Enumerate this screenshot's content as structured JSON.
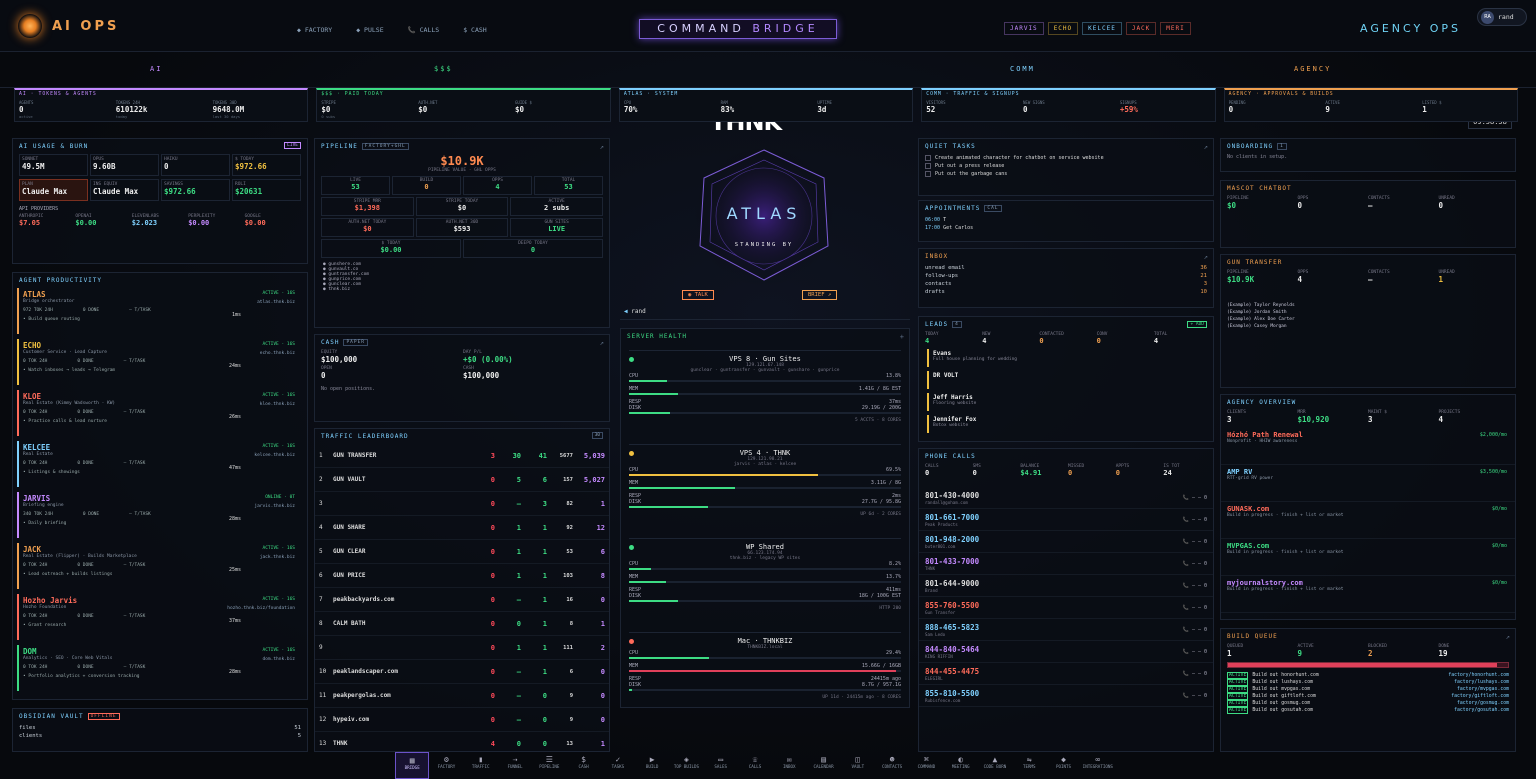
{
  "header": {
    "brand": "AI OPS",
    "nav": [
      "◆ FACTORY",
      "◆ PULSE",
      "📞 CALLS",
      "$ CASH"
    ],
    "title_a": "COMMAND ",
    "title_b": "BRIDGE",
    "agents": [
      "JARVIS",
      "ECHO",
      "KELCEE",
      "JACK",
      "MERI"
    ],
    "agency": "AGENCY OPS",
    "user_initials": "RA",
    "user_name": "rand"
  },
  "sections": {
    "ai": "AI",
    "money": "$$$",
    "brand": "THNK",
    "comm": "COMM",
    "agency": "AGENCY",
    "clock": "09:58:58"
  },
  "stats": [
    {
      "h": "AI · TOKENS & AGENTS",
      "cells": [
        [
          "AGENTS",
          "0",
          "active"
        ],
        [
          "TOKENS 24H",
          "610122k",
          "today"
        ],
        [
          "TOKENS 30D",
          "9648.0M",
          "last 30 days"
        ]
      ]
    },
    {
      "h": "$$$ · PAID TODAY",
      "cells": [
        [
          "STRIPE",
          "$0",
          "0 subs"
        ],
        [
          "AUTH.NET",
          "$0",
          ""
        ],
        [
          "GUIDE $",
          "$0",
          ""
        ]
      ]
    },
    {
      "h": "ATLAS · SYSTEM",
      "cells": [
        [
          "CPU",
          "70%",
          ""
        ],
        [
          "RAM",
          "83%",
          ""
        ],
        [
          "UPTIME",
          "3d",
          ""
        ]
      ]
    },
    {
      "h": "COMM · TRAFFIC & SIGNUPS",
      "cells": [
        [
          "VISITORS",
          "52",
          ""
        ],
        [
          "NEW SIGNS",
          "0",
          ""
        ],
        [
          "SIGNUPS",
          "+59%",
          ""
        ]
      ]
    },
    {
      "h": "AGENCY · APPROVALS & BUILDS",
      "cells": [
        [
          "PENDING",
          "0",
          ""
        ],
        [
          "ACTIVE",
          "9",
          ""
        ],
        [
          "LISTED $",
          "1",
          ""
        ]
      ]
    }
  ],
  "ai_usage": {
    "title": "AI USAGE & BURN",
    "tag": "LIVE",
    "row1": [
      [
        "SONNET",
        "49.5M"
      ],
      [
        "OPUS",
        "9.60B"
      ],
      [
        "HAIKU",
        "0"
      ],
      [
        "$ TODAY",
        "$972.66"
      ]
    ],
    "row2": [
      [
        "PLAN",
        "Claude Max"
      ],
      [
        "INS EQUIV",
        "Claude Max"
      ],
      [
        "SAVINGS",
        "$972.66"
      ],
      [
        "ROLI",
        "$20631"
      ]
    ],
    "providers_label": "API PROVIDERS",
    "providers": [
      [
        "ANTHROPIC",
        "$7.05"
      ],
      [
        "OPENAI",
        "$0.00"
      ],
      [
        "ELEVENLABS",
        "$2.023"
      ],
      [
        "PERPLEXITY",
        "$0.00"
      ],
      [
        "GOOGLE",
        "$0.00"
      ]
    ]
  },
  "agents_title": "AGENT PRODUCTIVITY",
  "agents": [
    {
      "name": "ATLAS",
      "color": "#f0a050",
      "status": "ACTIVE · 16S",
      "host": "atlas.thnk.biz",
      "desc": "Bridge orchestrator",
      "tok": "972 TOK 24H",
      "done": "0 DONE",
      "task": "— T/TASK",
      "ms": "1ms",
      "next": "• Build queue routing"
    },
    {
      "name": "ECHO",
      "color": "#f0c040",
      "status": "ACTIVE · 16S",
      "host": "echo.thnk.biz",
      "desc": "Customer Service · Lead Capture",
      "tok": "0 TOK 24H",
      "done": "0 DONE",
      "task": "— T/TASK",
      "ms": "24ms",
      "next": "• Watch inboxes → leads → Telegram"
    },
    {
      "name": "KLOE",
      "color": "#ff6b5a",
      "status": "ACTIVE · 16S",
      "host": "kloe.thnk.biz",
      "desc": "Real Estate (Kimmy Wadsworth · KW)",
      "tok": "0 TOK 24H",
      "done": "0 DONE",
      "task": "— T/TASK",
      "ms": "26ms",
      "next": "• Practice calls & lead nurture"
    },
    {
      "name": "KELCEE",
      "color": "#7fd1ff",
      "status": "ACTIVE · 16S",
      "host": "kelcee.thnk.biz",
      "desc": "Real Estate",
      "tok": "0 TOK 24H",
      "done": "0 DONE",
      "task": "— T/TASK",
      "ms": "47ms",
      "next": "• Listings & showings"
    },
    {
      "name": "JARVIS",
      "color": "#c48aff",
      "status": "ONLINE · 0T",
      "host": "jarvis.thnk.biz",
      "desc": "Briefing engine",
      "tok": "340 TOK 24H",
      "done": "0 DONE",
      "task": "— T/TASK",
      "ms": "28ms",
      "next": "• Daily briefing"
    },
    {
      "name": "JACK",
      "color": "#f0a050",
      "status": "ACTIVE · 16S",
      "host": "jack.thnk.biz",
      "desc": "Real Estate (Flipper) · Builds Marketplace",
      "tok": "0 TOK 24H",
      "done": "0 DONE",
      "task": "— T/TASK",
      "ms": "25ms",
      "next": "• Lead outreach + builds listings"
    },
    {
      "name": "Hozho Jarvis",
      "color": "#ff6b5a",
      "status": "ACTIVE · 16S",
      "host": "hozho.thnk.biz/foundation",
      "desc": "Hozho Foundation",
      "tok": "0 TOK 24H",
      "done": "0 DONE",
      "task": "— T/TASK",
      "ms": "37ms",
      "next": "• Grant research"
    },
    {
      "name": "DOM",
      "color": "#3ddc84",
      "status": "ACTIVE · 16S",
      "host": "dom.thnk.biz",
      "desc": "Analytics · SEO · Core Web Vitals",
      "tok": "0 TOK 24H",
      "done": "0 DONE",
      "task": "— T/TASK",
      "ms": "28ms",
      "next": "• Portfolio analytics + conversion tracking"
    }
  ],
  "vault": {
    "title": "OBSIDIAN VAULT",
    "tag": "OFFLINE",
    "rows": [
      [
        "files",
        "51"
      ],
      [
        "clients",
        "5"
      ]
    ]
  },
  "pipeline": {
    "title": "PIPELINE",
    "tag": "FACTORY+GHL",
    "big": "$10.9K",
    "sub": "PIPELINE VALUE · GHL OPPS",
    "r1": [
      [
        "LIVE",
        "53"
      ],
      [
        "BUILD",
        "0"
      ],
      [
        "OPPS",
        "4"
      ],
      [
        "TOTAL",
        "53"
      ]
    ],
    "r2": [
      [
        "STRIPE MRR",
        "$1,398"
      ],
      [
        "STRIPE TODAY",
        "$0"
      ],
      [
        "ACTIVE",
        "2 subs"
      ]
    ],
    "r3": [
      [
        "AUTH.NET TODAY",
        "$0"
      ],
      [
        "AUTH.NET 30D",
        "$593"
      ],
      [
        "GUN SITES",
        "LIVE"
      ]
    ],
    "r4": [
      [
        "$ TODAY",
        "$0.00"
      ],
      [
        "DEEPO TODAY",
        "0"
      ]
    ],
    "sites": [
      "gunshere.com",
      "gunvault.co",
      "guntransfer.com",
      "gunprice.com",
      "gunclear.com",
      "thnk.biz"
    ]
  },
  "cash": {
    "title": "CASH",
    "tag": "PAPER",
    "equity_l": "EQUITY",
    "equity": "$100,000",
    "pnl_l": "DAY P/L",
    "pnl": "+$0 (0.00%)",
    "open_l": "OPEN",
    "open": "0",
    "cash_l": "CASH",
    "cash": "$100,000",
    "note": "No open positions."
  },
  "traffic": {
    "title": "TRAFFIC LEADERBOARD",
    "tag": "30",
    "rows": [
      {
        "rank": "1",
        "name": "GUN TRANSFER",
        "a": "3",
        "b": "30",
        "c": "41",
        "d": "5677",
        "e": "5,039",
        "col": "#f0a050"
      },
      {
        "rank": "2",
        "name": "GUN VAULT",
        "a": "0",
        "b": "5",
        "c": "6",
        "d": "157",
        "e": "5,027",
        "col": "#f0a050"
      },
      {
        "rank": "3",
        "name": "",
        "a": "0",
        "b": "—",
        "c": "3",
        "d": "82",
        "e": "1",
        "col": "#ddd"
      },
      {
        "rank": "4",
        "name": "GUN SHARE",
        "a": "0",
        "b": "1",
        "c": "1",
        "d": "92",
        "e": "12",
        "col": "#ddd"
      },
      {
        "rank": "5",
        "name": "GUN CLEAR",
        "a": "0",
        "b": "1",
        "c": "1",
        "d": "53",
        "e": "6",
        "col": "#ddd"
      },
      {
        "rank": "6",
        "name": "GUN PRICE",
        "a": "0",
        "b": "1",
        "c": "1",
        "d": "103",
        "e": "8",
        "col": "#ddd"
      },
      {
        "rank": "7",
        "name": "peakbackyards.com",
        "a": "0",
        "b": "—",
        "c": "1",
        "d": "16",
        "e": "0",
        "col": "#ddd"
      },
      {
        "rank": "8",
        "name": "CALM BATH",
        "a": "0",
        "b": "0",
        "c": "1",
        "d": "8",
        "e": "1",
        "col": "#ddd"
      },
      {
        "rank": "9",
        "name": "",
        "a": "0",
        "b": "1",
        "c": "1",
        "d": "111",
        "e": "2",
        "col": "#ddd"
      },
      {
        "rank": "10",
        "name": "peaklandscaper.com",
        "a": "0",
        "b": "—",
        "c": "1",
        "d": "6",
        "e": "0",
        "col": "#ddd"
      },
      {
        "rank": "11",
        "name": "peakpergolas.com",
        "a": "0",
        "b": "—",
        "c": "0",
        "d": "9",
        "e": "0",
        "col": "#ddd"
      },
      {
        "rank": "12",
        "name": "hypeiv.com",
        "a": "0",
        "b": "—",
        "c": "0",
        "d": "9",
        "e": "0",
        "col": "#ddd"
      },
      {
        "rank": "13",
        "name": "THNK",
        "a": "4",
        "b": "0",
        "c": "0",
        "d": "13",
        "e": "1",
        "col": "#ddd"
      },
      {
        "rank": "14",
        "name": "",
        "a": "0",
        "b": "—",
        "c": "0",
        "d": "0",
        "e": "1",
        "col": "#ddd"
      }
    ]
  },
  "atlas": {
    "name": "ATLAS",
    "status": "STANDING BY",
    "talk": "◉ TALK",
    "brief": "BRIEF ↗",
    "user": "rand"
  },
  "servers": {
    "title": "SERVER HEALTH",
    "list": [
      {
        "name": "VPS 8 · Gun Sites",
        "ip": "129.121.67.148",
        "sub": "gunclear · guntransfer · gunvault · gunshare · gunprice",
        "cpu": "13.8%",
        "cpu_f": 0.138,
        "mem": "1.41G / 8G EST",
        "mem_f": 0.18,
        "resp": "37ms",
        "disk": "29.19G / 200G",
        "disk_f": 0.15,
        "foot": "5 ACCTS · 8 CORES",
        "color": "#3ddc84"
      },
      {
        "name": "VPS 4 · THNK",
        "ip": "129.121.98.21",
        "sub": "jarvis · atlas · kelcee",
        "cpu": "69.5%",
        "cpu_f": 0.695,
        "mem": "3.11G / 8G",
        "mem_f": 0.39,
        "resp": "2ms",
        "disk": "27.7G / 95.8G",
        "disk_f": 0.29,
        "foot": "UP 6d · 2 CORES",
        "color": "#f0c040"
      },
      {
        "name": "WP Shared",
        "ip": "66.123.174.94",
        "sub": "thnk.biz · legacy WP sites",
        "cpu": "8.2%",
        "cpu_f": 0.082,
        "mem": "13.7%",
        "mem_f": 0.137,
        "resp": "411ms",
        "disk": "18G / 100G EST",
        "disk_f": 0.18,
        "foot": "HTTP 200",
        "color": "#3ddc84"
      },
      {
        "name": "Mac · THNKBIZ",
        "ip": "THNKBIZ.local",
        "sub": "",
        "cpu": "29.4%",
        "cpu_f": 0.294,
        "mem": "15.66G / 16GB",
        "mem_f": 0.98,
        "resp": "24415m ago",
        "disk": "8.7G / 957.1G",
        "disk_f": 0.01,
        "foot": "UP 11d · 24415m ago · 8 CORES",
        "color": "#ff6b5a"
      }
    ]
  },
  "quiet": {
    "title": "QUIET TASKS",
    "tasks": [
      "Create animated character for chatbot on service website",
      "Put out a press release",
      "Put out the garbage cans"
    ]
  },
  "appts": {
    "title": "APPOINTMENTS",
    "tag": "CAL",
    "rows": [
      [
        "06:00",
        "T"
      ],
      [
        "17:00",
        "Get Carlos"
      ]
    ]
  },
  "inbox": {
    "title": "INBOX",
    "rows": [
      [
        "unread email",
        "36"
      ],
      [
        "follow-ups",
        "21"
      ],
      [
        "contacts",
        "3"
      ],
      [
        "drafts",
        "10"
      ]
    ]
  },
  "leads": {
    "title": "LEADS",
    "tag": "4",
    "add": "+ ADD",
    "stats": [
      [
        "TODAY",
        "4"
      ],
      [
        "NEW",
        "4"
      ],
      [
        "CONTACTED",
        "0"
      ],
      [
        "CONV",
        "0"
      ],
      [
        "TOTAL",
        "4"
      ]
    ],
    "list": [
      [
        "Evans",
        "Full house planning for wedding"
      ],
      [
        "DR VOLT",
        ""
      ],
      [
        "Jeff Harris",
        "Flooring website"
      ],
      [
        "Jennifer Fox",
        "Botox website"
      ]
    ]
  },
  "phone": {
    "title": "PHONE CALLS",
    "stats": [
      [
        "CALLS",
        "0"
      ],
      [
        "SMS",
        "0"
      ],
      [
        "BALANCE",
        "$4.91"
      ],
      [
        "MISSED",
        "0"
      ],
      [
        "APPTS",
        "0"
      ],
      [
        "IS TOT",
        "24"
      ]
    ],
    "lines": [
      [
        "801-430-4000",
        "randall@goham.com",
        "#ddd"
      ],
      [
        "801-661-7000",
        "Peak Products",
        "#7fd1ff"
      ],
      [
        "801-948-2000",
        "buter801.com",
        "#7fd1ff"
      ],
      [
        "801-433-7000",
        "THNK",
        "#c48aff"
      ],
      [
        "801-644-9000",
        "Brand",
        "#ddd"
      ],
      [
        "855-760-5500",
        "Gun Transfer",
        "#ff6b5a"
      ],
      [
        "888-465-5823",
        "Sam Ledo",
        "#7fd1ff"
      ],
      [
        "844-840-5464",
        "KING RIFFIN",
        "#c48aff"
      ],
      [
        "844-455-4475",
        "ELEGIRL",
        "#ff6b5a"
      ],
      [
        "855-810-5500",
        "Rubisfence.com",
        "#7fd1ff"
      ]
    ]
  },
  "onboarding": {
    "title": "ONBOARDING",
    "tag": "1",
    "empty": "No clients in setup."
  },
  "mascot": {
    "title": "MASCOT CHATBOT",
    "stats": [
      [
        "PIPELINE",
        "$0"
      ],
      [
        "OPPS",
        "0"
      ],
      [
        "CONTACTS",
        "—"
      ],
      [
        "UNREAD",
        "0"
      ]
    ]
  },
  "guntransfer": {
    "title": "GUN TRANSFER",
    "stats": [
      [
        "PIPELINE",
        "$10.9K"
      ],
      [
        "OPPS",
        "4"
      ],
      [
        "CONTACTS",
        "—"
      ],
      [
        "UNREAD",
        "1"
      ]
    ],
    "contacts": [
      "(Example) Taylor Reynolds",
      "(Example) Jordan Smith",
      "(Example) Alex Doe Carter",
      "(Example) Casey Morgan"
    ]
  },
  "agency": {
    "title": "AGENCY OVERVIEW",
    "stats": [
      [
        "CLIENTS",
        "3"
      ],
      [
        "MRR",
        "$10,920"
      ],
      [
        "MAINT $",
        "3"
      ],
      [
        "PROJECTS",
        "4"
      ]
    ],
    "projects": [
      [
        "Hózhó Path Renewal",
        "$2,000/mo",
        "Nonprofit · HHIW awareness",
        "#ff6b5a"
      ],
      [
        "AMP RV",
        "$3,500/mo",
        "RTT-grid RV power",
        "#7fd1ff"
      ],
      [
        "GUNASK.com",
        "$0/mo",
        "Build in progress · finish + list or market",
        "#ff6b5a"
      ],
      [
        "MVPGAS.com",
        "$0/mo",
        "Build in progress · finish + list or market",
        "#3ddc84"
      ],
      [
        "myjournalstory.com",
        "$0/mo",
        "Build in progress · finish + list or market",
        "#c48aff"
      ]
    ]
  },
  "buildq": {
    "title": "BUILD QUEUE",
    "stats": [
      [
        "QUEUED",
        "1"
      ],
      [
        "ACTIVE",
        "9"
      ],
      [
        "BLOCKED",
        "2"
      ],
      [
        "DONE",
        "19"
      ]
    ],
    "items": [
      [
        "Build out honorhunt.com",
        "factory/honorhunt.com"
      ],
      [
        "Build out lushays.com",
        "factory/lushays.com"
      ],
      [
        "Build out mvpgas.com",
        "factory/mvpgas.com"
      ],
      [
        "Build out giftloft.com",
        "factory/giftloft.com"
      ],
      [
        "Build out gosmug.com",
        "factory/gosmug.com"
      ],
      [
        "Build out gosutah.com",
        "factory/gosutah.com"
      ]
    ]
  },
  "dock": [
    "BRIDGE",
    "FACTORY",
    "TRAFFIC",
    "FUNNEL",
    "PIPELINE",
    "CASH",
    "TASKS",
    "BUILD",
    "TOP BUILDS",
    "SALES",
    "CALLS",
    "INBOX",
    "CALENDAR",
    "VAULT",
    "CONTACTS",
    "COMMAND",
    "MEETING",
    "CODE BURN",
    "TERMS",
    "POINTS",
    "INTEGRATIONS"
  ]
}
